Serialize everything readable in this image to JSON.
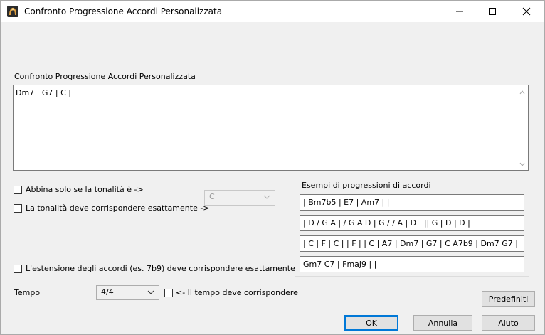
{
  "window": {
    "title": "Confronto Progressione Accordi Personalizzata",
    "minimize_glyph": "—",
    "maximize_glyph": "☐",
    "close_glyph": "✕"
  },
  "main": {
    "section_label": "Confronto Progressione Accordi Personalizzata",
    "progression_text": "Dm7 | G7 | C |"
  },
  "options": {
    "key_match_label": "Abbina solo se la tonalità è ->",
    "key_exact_label": "La tonalità deve corrispondere esattamente ->",
    "key_select_value": "C",
    "extension_exact_label": "L'estensione degli accordi (es. 7b9) deve corrispondere esattamente"
  },
  "tempo": {
    "label": "Tempo",
    "select_value": "4/4",
    "must_match_label": "<- Il tempo deve corrispondere"
  },
  "examples": {
    "title": "Esempi di progressioni di accordi",
    "items": [
      "| Bm7b5 | E7 | Am7 |  |",
      "| D / G A | / G A D | G / / A | D |  || G  | D | D |",
      "| C | F | C |  | F  |   | C | A7 | Dm7 | G7 | C A7b9 | Dm7 G7 |",
      "Gm7 C7 | Fmaj9 |  |"
    ]
  },
  "buttons": {
    "defaults": "Predefiniti",
    "ok": "OK",
    "cancel": "Annulla",
    "help": "Aiuto"
  },
  "icons": {
    "app": "band-in-a-box-icon",
    "scroll_up": "chevron-up-icon",
    "scroll_down": "chevron-down-icon",
    "dropdown": "chevron-down-icon"
  },
  "colors": {
    "accent": "#0078d7",
    "window_bg": "#f0f0f0"
  }
}
